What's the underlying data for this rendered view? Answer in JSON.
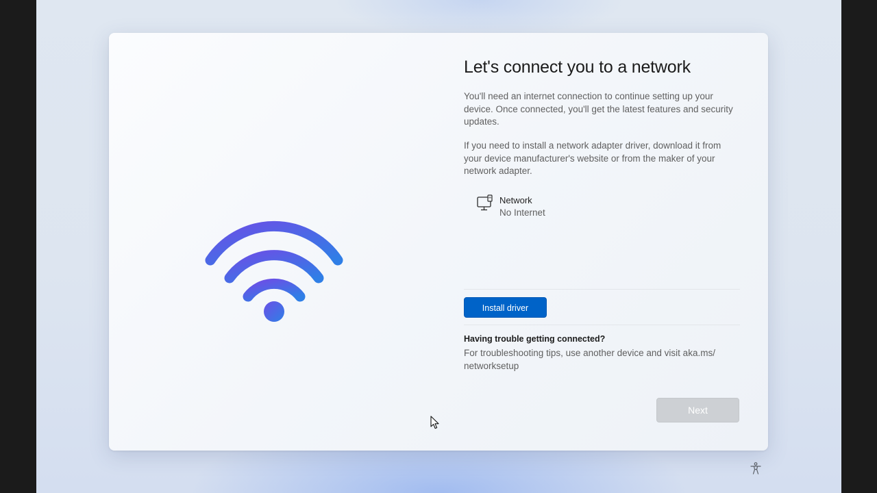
{
  "setup": {
    "title": "Let's connect you to a network",
    "paragraph1": "You'll need an internet connection to continue setting up your device. Once connected, you'll get the latest features and security updates.",
    "paragraph2": "If you need to install a network adapter driver, download it from your device manufacturer's website or from the maker of your network adapter."
  },
  "network": {
    "icon": "wired-network-icon",
    "name": "Network",
    "status": "No Internet"
  },
  "buttons": {
    "install_driver": "Install driver",
    "next": "Next",
    "next_enabled": false
  },
  "help": {
    "heading": "Having trouble getting connected?",
    "body": "For troubleshooting tips, use another device and visit aka.ms/ networksetup"
  },
  "illustration": {
    "icon": "wifi-icon",
    "gradient_start": "#6a50e6",
    "gradient_end": "#2f7fe6"
  },
  "colors": {
    "accent": "#0063c8",
    "disabled_button": "#cdd0d4"
  }
}
